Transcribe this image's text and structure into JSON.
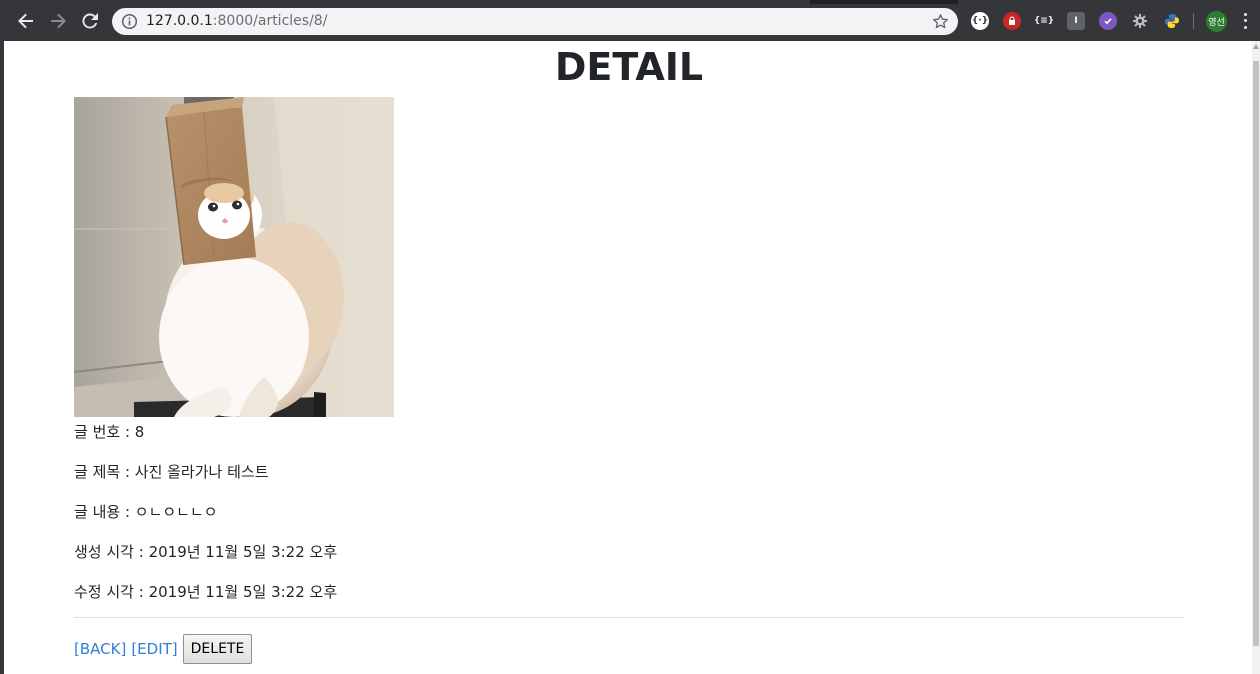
{
  "browser": {
    "url_host": "127.0.0.1",
    "url_path": ":8000/articles/8/",
    "profile_initials": "영선",
    "extensions": [
      "json-viewer-icon",
      "security-icon",
      "code-icon",
      "ublock-icon",
      "check-icon",
      "gear-icon",
      "python-icon"
    ]
  },
  "page": {
    "title": "DETAIL",
    "image_alt": "cat with paper bag on head",
    "fields": [
      {
        "label": "글 번호",
        "sep": " : ",
        "value": "8"
      },
      {
        "label": "글 제목",
        "sep": " : ",
        "value": "사진 올라가나 테스트"
      },
      {
        "label": "글 내용",
        "sep": " : ",
        "value": "ㅇㄴㅇㄴㄴㅇ"
      },
      {
        "label": "생성 시각",
        "sep": " : ",
        "value": "2019년 11월 5일 3:22 오후"
      },
      {
        "label": "수정 시각",
        "sep": " : ",
        "value": "2019년 11월 5일 3:22 오후"
      }
    ],
    "actions": {
      "back_label": "[BACK]",
      "edit_label": "[EDIT]",
      "delete_label": "DELETE"
    }
  },
  "colors": {
    "link": "#2f7ed8",
    "text": "#212529",
    "chrome": "#35363a"
  }
}
